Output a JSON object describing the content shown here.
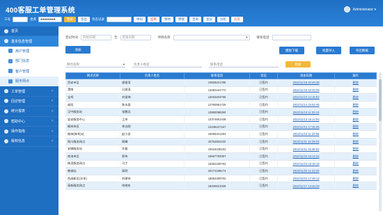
{
  "header": {
    "title": "400客服工单管理系统",
    "user": "Administrator ▾",
    "toolbar": [
      {
        "label": "工号",
        "type": "label"
      },
      {
        "label": "",
        "type": "box"
      },
      {
        "label": "坐席",
        "type": "label"
      },
      {
        "label": "●●●●●●●●",
        "type": "box"
      },
      {
        "label": "登录",
        "type": "btn-y"
      },
      {
        "label": "签出",
        "type": "btn-w"
      },
      {
        "label": "状态记录",
        "type": "label"
      },
      {
        "label": "",
        "type": "box"
      },
      {
        "label": "呼叫",
        "type": "btn-w"
      },
      {
        "label": "挂断",
        "type": "btn-r"
      },
      {
        "label": "保持",
        "type": "btn-w"
      },
      {
        "label": "转接",
        "type": "btn-w"
      },
      {
        "label": "咨询",
        "type": "btn-w"
      },
      {
        "label": "会议",
        "type": "btn-w"
      },
      {
        "label": "分机",
        "type": "btn-w"
      },
      {
        "label": "应答",
        "type": "btn-r"
      }
    ]
  },
  "sidebar": {
    "items": [
      {
        "label": "首页",
        "type": "top",
        "active": false
      },
      {
        "label": "基本信息管理",
        "type": "top",
        "active": true
      },
      {
        "label": "用户管理",
        "type": "sub"
      },
      {
        "label": "部门信息",
        "type": "sub"
      },
      {
        "label": "客户管理",
        "type": "sub"
      },
      {
        "label": "服务网点",
        "type": "sub",
        "current": true
      },
      {
        "label": "工单管理",
        "type": "top"
      },
      {
        "label": "回访管理",
        "type": "top"
      },
      {
        "label": "统计报表",
        "type": "top"
      },
      {
        "label": "帮助中心",
        "type": "top"
      },
      {
        "label": "操作指南",
        "type": "top"
      },
      {
        "label": "版权信息",
        "type": "top"
      }
    ]
  },
  "filters": {
    "date_label": "登记时间",
    "date_start": "开始日期",
    "to": "至",
    "date_end": "结束日期",
    "proj_label": "项目名称",
    "proj_value": "",
    "contact_label": "联系电话",
    "contact_value": ""
  },
  "buttons": {
    "add": "添加",
    "download": "模板下载",
    "import": "批量导入",
    "export": "导出数据",
    "search": "检索"
  },
  "search": {
    "type_placeholder": "网点名称",
    "name_placeholder": "负责人姓名",
    "phone_placeholder": "联系电话"
  },
  "table": {
    "headers": [
      "网点名称",
      "负责人姓名",
      "联系电话",
      "状态",
      "添加日期",
      "操作"
    ],
    "rows": [
      [
        "西安市区",
        "谢振涛",
        "13828221766",
        "已签约",
        "2022/11/18 20:49:48",
        "删除"
      ],
      [
        "渭南",
        "吕振涛",
        "13383181772",
        "已签约",
        "2022/11/15 16:33:29",
        "删除"
      ],
      [
        "宝鸡",
        "刘振坤",
        "13033203755",
        "已签约",
        "2022/11/10 14:15:52",
        "删除"
      ],
      [
        "咸阳",
        "陈永昌",
        "13780991725",
        "已签约",
        "2022/11/14 15:52:45",
        "删除"
      ],
      [
        "汉中服务站",
        "张鹏远",
        "13860098260",
        "已签约",
        "2022/11/13 11:32:19",
        "删除"
      ],
      [
        "延安服务中心",
        "王伟",
        "13374851438",
        "已签约",
        "2022/11/13 16:14:04",
        "删除"
      ],
      [
        "榆林市区",
        "李志刚",
        "13236227167",
        "已签约",
        "2022/11/12 17:32:25",
        "删除"
      ],
      [
        "榆林(神木)站",
        "赵小龙",
        "15065341253",
        "已签约",
        "2022/11/12 11:29:56",
        "删除"
      ],
      [
        "铜川服务网点",
        "周峰",
        "15762654102",
        "已签约",
        "2022/11/11 15:38:03",
        "删除"
      ],
      [
        "安康服务站",
        "孙磊",
        "15516435152",
        "已签约",
        "2022/11/11 15:38:02",
        "删除"
      ],
      [
        "商洛市区",
        "郭伟",
        "15567763367",
        "已签约",
        "2022/11/23 15:14:22",
        "删除"
      ],
      [
        "杨凌服务网点",
        "马丁",
        "18363180762",
        "已签约",
        "2022/11/23 16:15:19",
        "删除"
      ],
      [
        "韩城站",
        "高明",
        "18174188174",
        "已签约",
        "2022/11/20 11:33:20",
        "删除"
      ],
      [
        "西咸新区(沣东)",
        "刘建伟",
        "18664359762",
        "已签约",
        "2022/11/22 17:35:13",
        "删除"
      ],
      [
        "高新服务网点",
        "徐晓东",
        "18320613329",
        "已签约",
        "2022/11/17 13:45:29",
        "删除"
      ]
    ]
  },
  "colors": {
    "primary": "#2a7ad0",
    "accent": "#f3b73b",
    "sidebar": "#1e6ec2",
    "danger": "#d9534f"
  }
}
